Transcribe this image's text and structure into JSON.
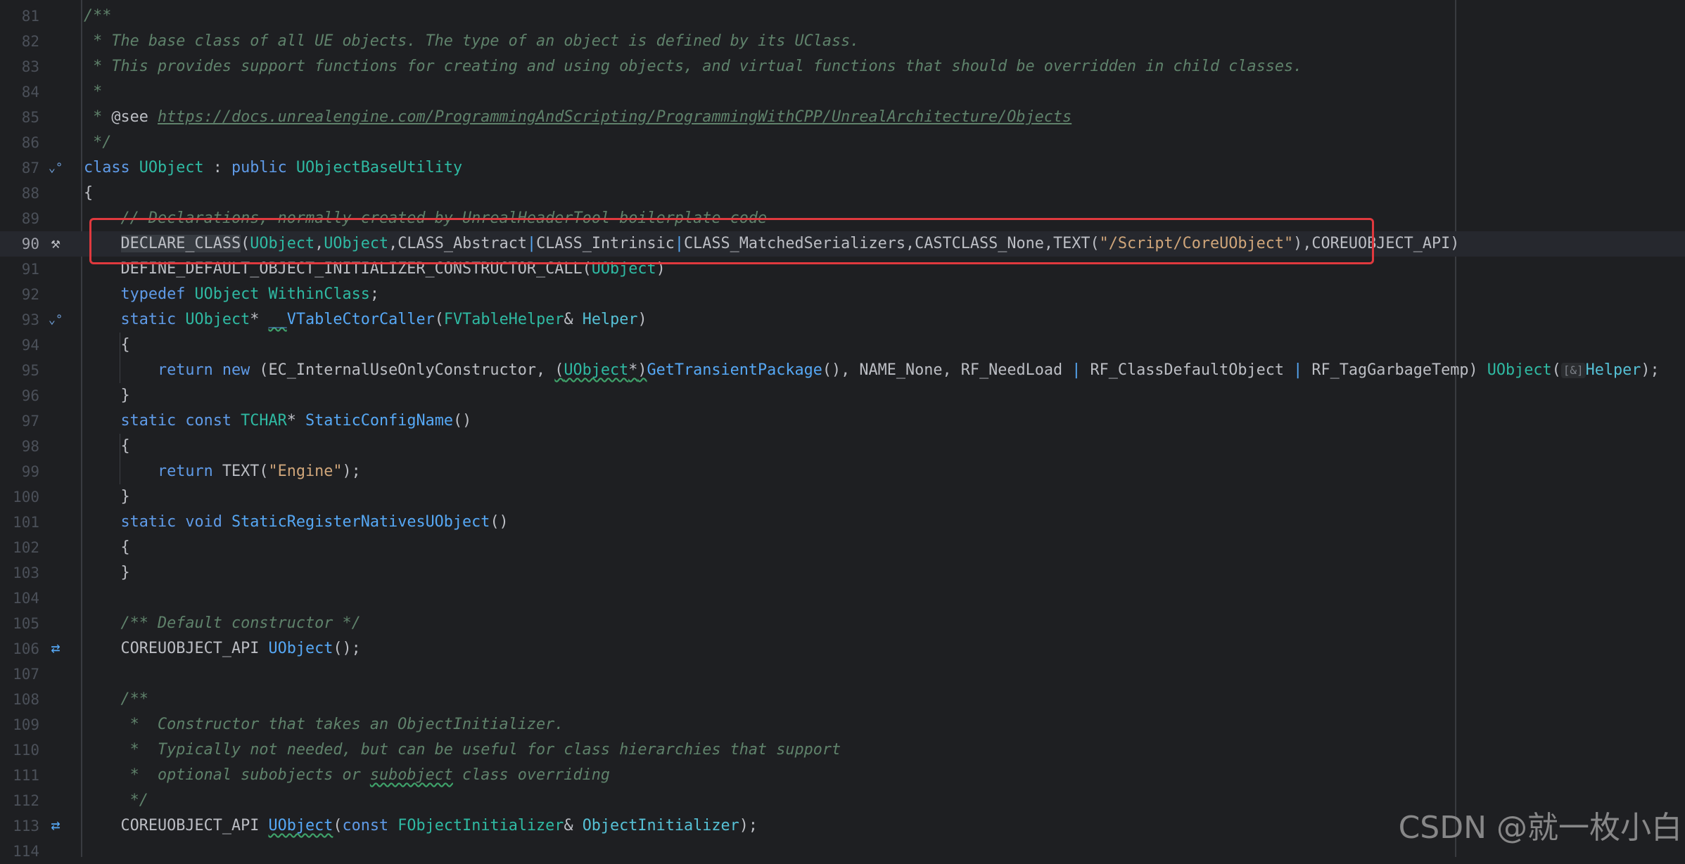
{
  "editor": {
    "lines": [
      {
        "n": "81",
        "tokens": [
          [
            "doc",
            "/**"
          ]
        ]
      },
      {
        "n": "82",
        "tokens": [
          [
            "doc",
            " * The base class of all UE objects. The type of an object is defined by its UClass."
          ]
        ]
      },
      {
        "n": "83",
        "tokens": [
          [
            "doc",
            " * This provides support functions for creating and using objects, and virtual functions that should be overridden in child classes."
          ]
        ]
      },
      {
        "n": "84",
        "tokens": [
          [
            "doc",
            " *"
          ]
        ]
      },
      {
        "n": "85",
        "tokens": [
          [
            "doc",
            " * "
          ],
          [
            "pl",
            "@see"
          ],
          [
            "doc",
            " "
          ],
          [
            "link",
            "https://docs.unrealengine.com/ProgrammingAndScripting/ProgrammingWithCPP/UnrealArchitecture/Objects"
          ]
        ]
      },
      {
        "n": "86",
        "tokens": [
          [
            "doc",
            " */"
          ]
        ]
      },
      {
        "n": "87",
        "icon": "override-down-icon",
        "tokens": [
          [
            "kw",
            "class "
          ],
          [
            "ty",
            "UObject"
          ],
          [
            "pl",
            " : "
          ],
          [
            "kw",
            "public "
          ],
          [
            "ty",
            "UObjectBaseUtility"
          ]
        ]
      },
      {
        "n": "88",
        "tokens": [
          [
            "pl",
            "{"
          ]
        ]
      },
      {
        "n": "89",
        "tokens": [
          [
            "pl",
            "    "
          ],
          [
            "cmstrike",
            "// Declarations, normally created by UnrealHeaderTool boilerplate code"
          ]
        ]
      },
      {
        "n": "90",
        "icon": "hammer-icon",
        "current": true,
        "tokens": [
          [
            "pl",
            "    "
          ],
          [
            "hlmac",
            "DECLARE_CLASS"
          ],
          [
            "pl",
            "("
          ],
          [
            "ty",
            "UObject"
          ],
          [
            "pl",
            ","
          ],
          [
            "ty",
            "UObject"
          ],
          [
            "pl",
            ",CLASS_Abstract"
          ],
          [
            "op",
            "|"
          ],
          [
            "pl",
            "CLASS_Intrinsic"
          ],
          [
            "op",
            "|"
          ],
          [
            "pl",
            "CLASS_MatchedSerializers,CASTCLASS_None,TEXT("
          ],
          [
            "str2",
            "\"/Script/CoreUObject\""
          ],
          [
            "pl",
            "),COREUOBJECT_API)"
          ]
        ]
      },
      {
        "n": "91",
        "tokens": [
          [
            "pl",
            "    DEFINE_DEFAULT_OBJECT_INITIALIZER_CONSTRUCTOR_CALL("
          ],
          [
            "ty",
            "UObject"
          ],
          [
            "pl",
            ")"
          ]
        ]
      },
      {
        "n": "92",
        "tokens": [
          [
            "pl",
            "    "
          ],
          [
            "kw",
            "typedef "
          ],
          [
            "ty",
            "UObject WithinClass"
          ],
          [
            "pl",
            ";"
          ]
        ]
      },
      {
        "n": "93",
        "icon": "override-down-icon",
        "tokens": [
          [
            "pl",
            "    "
          ],
          [
            "kw",
            "static "
          ],
          [
            "ty",
            "UObject"
          ],
          [
            "pl",
            "* "
          ],
          [
            "fnsq",
            "__"
          ],
          [
            "fn",
            "VTableCtorCaller"
          ],
          [
            "pl",
            "("
          ],
          [
            "ty",
            "FVTableHelper"
          ],
          [
            "pl",
            "& "
          ],
          [
            "par",
            "Helper"
          ],
          [
            "pl",
            ")"
          ]
        ]
      },
      {
        "n": "94",
        "tokens": [
          [
            "pl",
            "    {"
          ]
        ]
      },
      {
        "n": "95",
        "guide": true,
        "tokens": [
          [
            "pl",
            "        "
          ],
          [
            "kw",
            "return new "
          ],
          [
            "pl",
            "(EC_InternalUseOnlyConstructor, "
          ],
          [
            "sq",
            "("
          ],
          [
            "sqty",
            "UObject"
          ],
          [
            "sq",
            "*"
          ],
          [
            "sq",
            ")"
          ],
          [
            "fn",
            "GetTransientPackage"
          ],
          [
            "pl",
            "(), NAME_None, RF_NeedLoad "
          ],
          [
            "op",
            "|"
          ],
          [
            "pl",
            " RF_ClassDefaultObject "
          ],
          [
            "op",
            "|"
          ],
          [
            "pl",
            " RF_TagGarbageTemp) "
          ],
          [
            "ty",
            "UObject"
          ],
          [
            "pl",
            "("
          ],
          [
            "hint",
            "[&]"
          ],
          [
            "par",
            "Helper"
          ],
          [
            "pl",
            ");"
          ]
        ]
      },
      {
        "n": "96",
        "tokens": [
          [
            "pl",
            "    }"
          ]
        ]
      },
      {
        "n": "97",
        "tokens": [
          [
            "pl",
            "    "
          ],
          [
            "kw",
            "static const "
          ],
          [
            "ty",
            "TCHAR"
          ],
          [
            "pl",
            "* "
          ],
          [
            "fn",
            "StaticConfigName"
          ],
          [
            "pl",
            "()"
          ]
        ]
      },
      {
        "n": "98",
        "tokens": [
          [
            "pl",
            "    {"
          ]
        ]
      },
      {
        "n": "99",
        "guide": true,
        "tokens": [
          [
            "pl",
            "        "
          ],
          [
            "kw",
            "return "
          ],
          [
            "pl",
            "TEXT("
          ],
          [
            "str2",
            "\"Engine\""
          ],
          [
            "pl",
            ");"
          ]
        ]
      },
      {
        "n": "100",
        "tokens": [
          [
            "pl",
            "    }"
          ]
        ]
      },
      {
        "n": "101",
        "tokens": [
          [
            "pl",
            "    "
          ],
          [
            "kw",
            "static void "
          ],
          [
            "fn",
            "StaticRegisterNativesUObject"
          ],
          [
            "pl",
            "()"
          ]
        ]
      },
      {
        "n": "102",
        "tokens": [
          [
            "pl",
            "    {"
          ]
        ]
      },
      {
        "n": "103",
        "tokens": [
          [
            "pl",
            "    }"
          ]
        ]
      },
      {
        "n": "104",
        "tokens": []
      },
      {
        "n": "105",
        "tokens": [
          [
            "pl",
            "    "
          ],
          [
            "doc",
            "/** Default constructor */"
          ]
        ]
      },
      {
        "n": "106",
        "icon": "swap-icon",
        "tokens": [
          [
            "pl",
            "    COREUOBJECT_API "
          ],
          [
            "fn",
            "UObject"
          ],
          [
            "pl",
            "();"
          ]
        ]
      },
      {
        "n": "107",
        "tokens": []
      },
      {
        "n": "108",
        "tokens": [
          [
            "pl",
            "    "
          ],
          [
            "doc",
            "/**"
          ]
        ]
      },
      {
        "n": "109",
        "tokens": [
          [
            "pl",
            "    "
          ],
          [
            "doc",
            " *  Constructor that takes an ObjectInitializer."
          ]
        ]
      },
      {
        "n": "110",
        "tokens": [
          [
            "pl",
            "    "
          ],
          [
            "doc",
            " *  Typically not needed, but can be useful for class hierarchies that support"
          ]
        ]
      },
      {
        "n": "111",
        "tokens": [
          [
            "pl",
            "    "
          ],
          [
            "doc",
            " *  optional subobjects or "
          ],
          [
            "docsq",
            "subobject"
          ],
          [
            "doc",
            " class overriding"
          ]
        ]
      },
      {
        "n": "112",
        "tokens": [
          [
            "pl",
            "    "
          ],
          [
            "doc",
            " */"
          ]
        ]
      },
      {
        "n": "113",
        "icon": "swap-icon",
        "tokens": [
          [
            "pl",
            "    COREUOBJECT_API "
          ],
          [
            "fnsq",
            "UObject"
          ],
          [
            "pl",
            "("
          ],
          [
            "kw",
            "const "
          ],
          [
            "ty",
            "FObjectInitializer"
          ],
          [
            "pl",
            "& "
          ],
          [
            "par",
            "ObjectInitializer"
          ],
          [
            "pl",
            ");"
          ]
        ]
      },
      {
        "n": "114",
        "tokens": []
      }
    ]
  },
  "icons": {
    "override-down-icon": "⌄°",
    "hammer-icon": "⚒",
    "swap-icon": "⇄"
  },
  "watermark": "CSDN @就一枚小白"
}
